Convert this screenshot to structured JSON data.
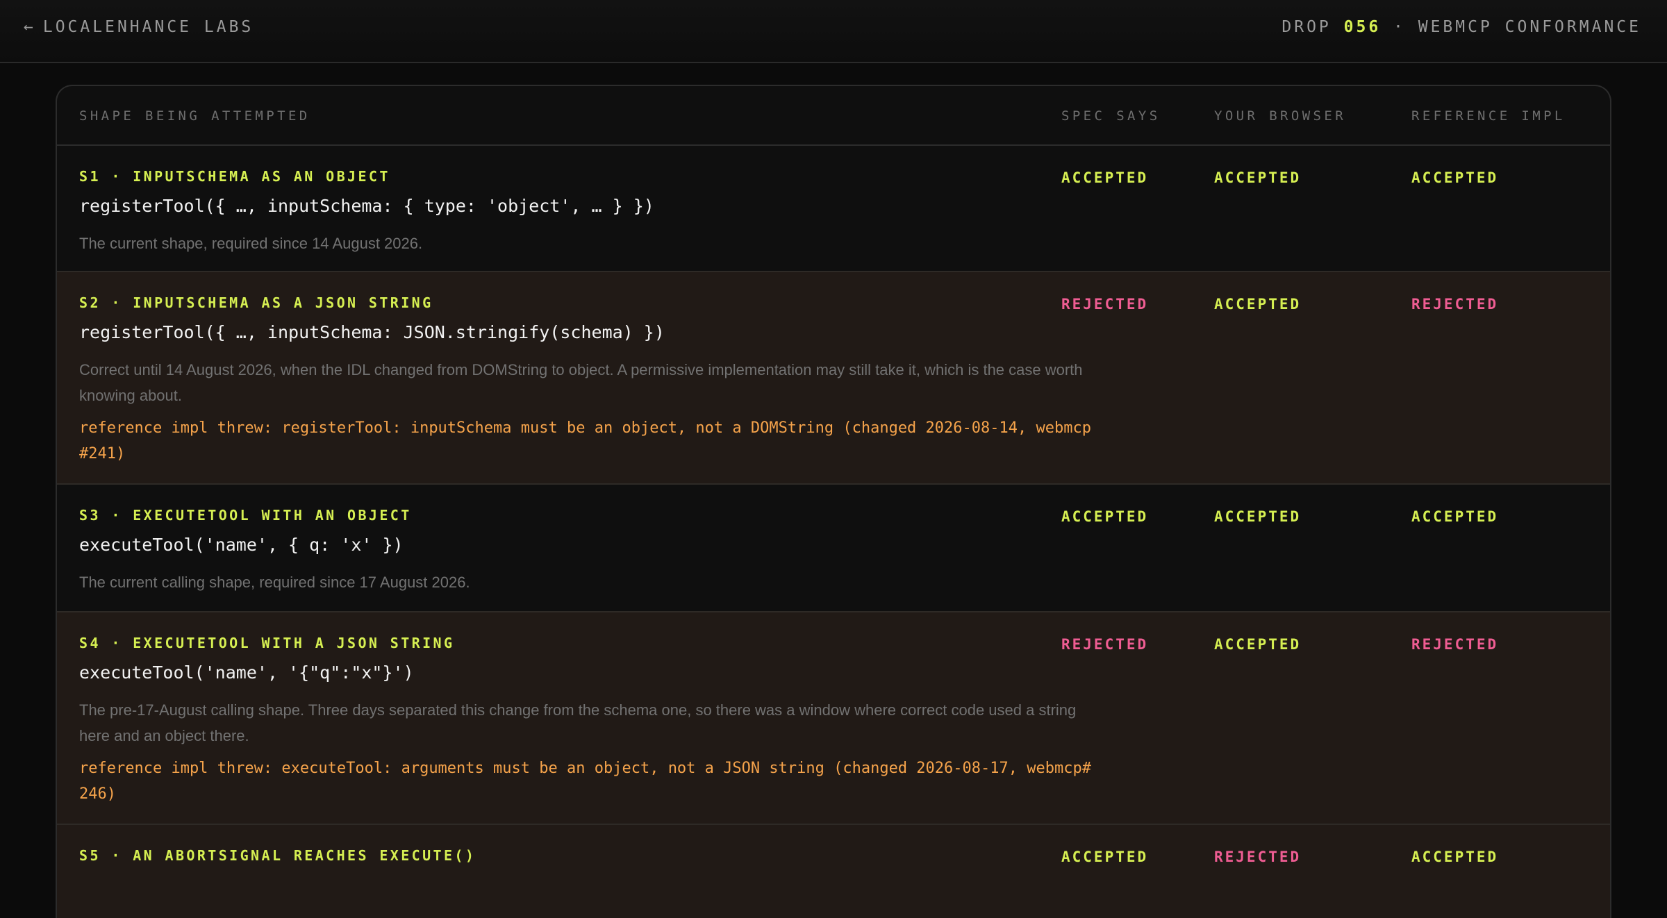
{
  "header": {
    "back_arrow": "←",
    "brand": "LOCALENHANCE LABS",
    "drop_prefix": "DROP",
    "drop_number": "056",
    "drop_suffix": "· WEBMCP CONFORMANCE"
  },
  "table": {
    "headers": [
      "SHAPE BEING ATTEMPTED",
      "SPEC SAYS",
      "YOUR BROWSER",
      "REFERENCE IMPL"
    ],
    "rows": [
      {
        "label": "S1 · INPUTSCHEMA AS AN OBJECT",
        "code": "registerTool({ …, inputSchema: { type: 'object', … } })",
        "description": "The current shape, required since 14 August 2026.",
        "error": "",
        "spec": "ACCEPTED",
        "browser": "ACCEPTED",
        "reference": "ACCEPTED"
      },
      {
        "label": "S2 · INPUTSCHEMA AS A JSON STRING",
        "code": "registerTool({ …, inputSchema: JSON.stringify(schema) })",
        "description": "Correct until 14 August 2026, when the IDL changed from DOMString to object. A permissive implementation may still take it, which is the case worth knowing about.",
        "error": "reference impl threw: registerTool: inputSchema must be an object, not a DOMString (changed 2026-08-14, webmcp#241)",
        "spec": "REJECTED",
        "browser": "ACCEPTED",
        "reference": "REJECTED"
      },
      {
        "label": "S3 · EXECUTETOOL WITH AN OBJECT",
        "code": "executeTool('name', { q: 'x' })",
        "description": "The current calling shape, required since 17 August 2026.",
        "error": "",
        "spec": "ACCEPTED",
        "browser": "ACCEPTED",
        "reference": "ACCEPTED"
      },
      {
        "label": "S4 · EXECUTETOOL WITH A JSON STRING",
        "code": "executeTool('name', '{\"q\":\"x\"}')",
        "description": "The pre-17-August calling shape. Three days separated this change from the schema one, so there was a window where correct code used a string here and an object there.",
        "error": "reference impl threw: executeTool: arguments must be an object, not a JSON string (changed 2026-08-17, webmcp#246)",
        "spec": "REJECTED",
        "browser": "ACCEPTED",
        "reference": "REJECTED"
      },
      {
        "label": "S5 · AN ABORTSIGNAL REACHES EXECUTE()",
        "code": "",
        "description": "",
        "error": "",
        "spec": "ACCEPTED",
        "browser": "REJECTED",
        "reference": "ACCEPTED"
      }
    ]
  },
  "colors": {
    "accepted": "#d6ef52",
    "rejected": "#ef5d93",
    "error": "#f5a34b"
  }
}
